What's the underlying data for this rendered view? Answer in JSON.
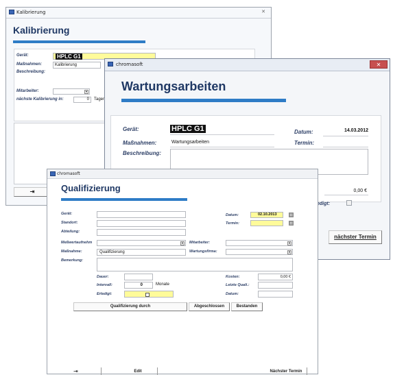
{
  "kalibrierung": {
    "window_title": "Kalibrierung",
    "heading": "Kalibrierung",
    "labels": {
      "geraet": "Gerät:",
      "massnahmen": "Maßnahmen:",
      "beschreibung": "Beschreibung:",
      "mitarbeiter": "Mitarbeiter:",
      "naechste": "nächste Kalibrierung in:"
    },
    "values": {
      "geraet": "HPLC G1",
      "massnahmen": "Kalibrierung",
      "naechste": "0",
      "tage": "Tagen"
    }
  },
  "wartung": {
    "window_title": "chromasoft",
    "heading": "Wartungsarbeiten",
    "labels": {
      "geraet": "Gerät:",
      "massnahmen": "Maßnahmen:",
      "beschreibung": "Beschreibung:",
      "datum": "Datum:",
      "termin": "Termin:",
      "kosten_partial": "x:",
      "erledigt_partial": "edigt:"
    },
    "values": {
      "geraet": "HPLC G1",
      "massnahmen": "Wartungsarbeiten",
      "datum": "14.03.2012",
      "kosten": "0,00 €"
    },
    "next_button": "nächster Termin",
    "close_icon": "close-icon"
  },
  "qualifizierung": {
    "window_title": "chromasoft",
    "heading": "Qualifizierung",
    "labels": {
      "geraet": "Gerät:",
      "standort": "Standort:",
      "abteilung": "Abteilung:",
      "datum": "Datum:",
      "termin": "Termin:",
      "messwert": "Meßwertaufnehm",
      "massnahme": "Maßnahme:",
      "bemerkung": "Bemerkung:",
      "mitarbeiter": "Mitarbeiter:",
      "wartungsfirma": "Wartungsfirma:",
      "dauer": "Dauer:",
      "intervall": "Intervall:",
      "erledigt": "Erledigt:",
      "kosten": "Kosten:",
      "letzte": "Letzte Quali.:",
      "datum2": "Datum:"
    },
    "values": {
      "datum": "02.10.2013",
      "massnahme": "Qualifizierung",
      "intervall": "0",
      "monate": "Monate",
      "kosten": "0,00 €"
    },
    "buttons": {
      "durch": "Qualifizierung durch",
      "abgeschlossen": "Abgeschlossen",
      "bestanden": "Bestanden",
      "edit": "Edit",
      "naechster": "Nächster Termin"
    }
  }
}
